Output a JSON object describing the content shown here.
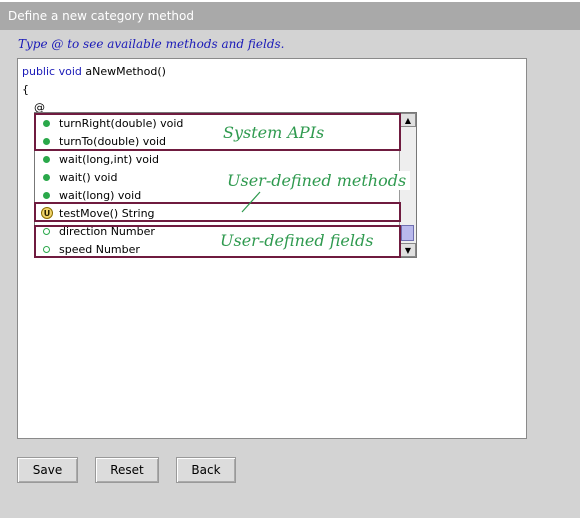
{
  "window": {
    "title": "Define a new category method"
  },
  "hint": "Type @ to see available methods and fields.",
  "editor": {
    "line1_kw": "public void",
    "line1_rest": " aNewMethod()",
    "line2": "{",
    "line3": "@"
  },
  "popup": {
    "items": [
      {
        "label": "turnRight(double) void",
        "icon": "filled-dot"
      },
      {
        "label": "turnTo(double) void",
        "icon": "filled-dot"
      },
      {
        "label": "wait(long,int) void",
        "icon": "filled-dot"
      },
      {
        "label": "wait() void",
        "icon": "filled-dot"
      },
      {
        "label": "wait(long) void",
        "icon": "filled-dot"
      },
      {
        "label": "testMove() String",
        "icon": "u-badge",
        "badge": "U"
      },
      {
        "label": "direction Number",
        "icon": "hollow-dot"
      },
      {
        "label": "speed Number",
        "icon": "hollow-dot"
      }
    ]
  },
  "annotations": {
    "system": "System APIs",
    "methods": "User-defined methods",
    "fields": "User-defined fields"
  },
  "buttons": {
    "save": "Save",
    "reset": "Reset",
    "back": "Back"
  },
  "colors": {
    "annotation": "#2f9a4f",
    "highlight": "#6f1b3f",
    "accent": "#1a1ab8"
  }
}
